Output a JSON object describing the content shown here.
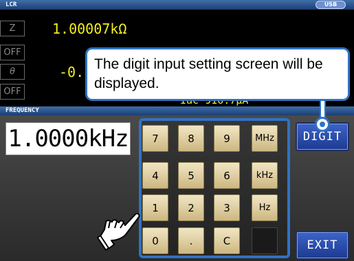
{
  "header": {
    "mode_label": "LCR",
    "usb_badge": "USB"
  },
  "measurements": {
    "rows": [
      {
        "param": "Z",
        "value": "1.00007kΩ"
      },
      {
        "param": "OFF",
        "value": ""
      },
      {
        "param": "θ",
        "value": "-0."
      },
      {
        "param": "OFF",
        "value": ""
      }
    ],
    "current_text": "Iac  916.7μA"
  },
  "frequency": {
    "section_label": "FREQUENCY",
    "display_value": "1.0000kHz"
  },
  "keypad": {
    "keys": [
      {
        "label": "7"
      },
      {
        "label": "8"
      },
      {
        "label": "9"
      },
      {
        "label": "MHz"
      },
      {
        "label": "4"
      },
      {
        "label": "5"
      },
      {
        "label": "6"
      },
      {
        "label": "kHz"
      },
      {
        "label": "1"
      },
      {
        "label": "2"
      },
      {
        "label": "3"
      },
      {
        "label": "Hz"
      },
      {
        "label": "0"
      },
      {
        "label": "."
      },
      {
        "label": "C"
      },
      {
        "label": ""
      }
    ]
  },
  "buttons": {
    "digit_label": "DIGIT",
    "exit_label": "EXIT"
  },
  "callout": {
    "text": "The digit input setting screen will be displayed."
  },
  "icons": {
    "pointer": "pointing-hand-icon"
  },
  "colors": {
    "accent_blue": "#2f72c4",
    "measurement_yellow": "#f4ef1a",
    "key_beige": "#e3d3a3",
    "button_blue": "#2d4fae",
    "title_bar": "#2a5590"
  }
}
